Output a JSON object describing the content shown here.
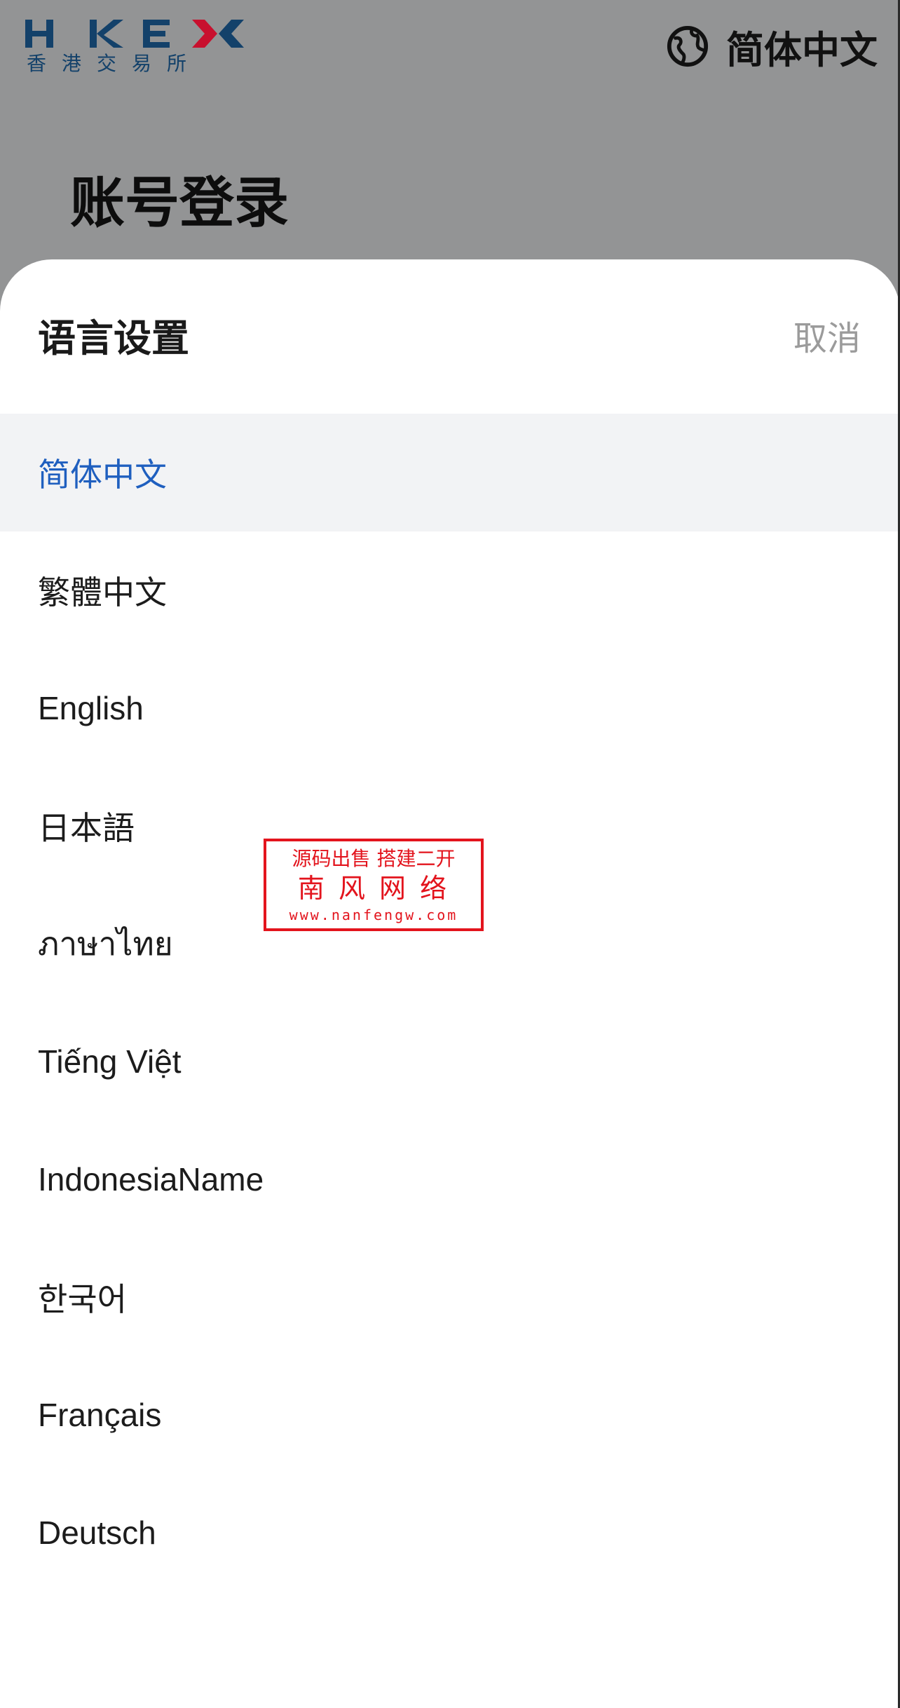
{
  "header": {
    "logo_text": "HKEX",
    "logo_subtext": "香港交易所",
    "globe_icon": "globe-icon",
    "current_language": "简体中文"
  },
  "page": {
    "title": "账号登录"
  },
  "language_sheet": {
    "title": "语言设置",
    "cancel_label": "取消",
    "selected_index": 0,
    "selected_color": "#1f5fbf",
    "options": [
      {
        "label": "简体中文"
      },
      {
        "label": "繁體中文"
      },
      {
        "label": "English"
      },
      {
        "label": "日本語"
      },
      {
        "label": "ภาษาไทย"
      },
      {
        "label": "Tiếng Việt"
      },
      {
        "label": "IndonesiaName"
      },
      {
        "label": "한국어"
      },
      {
        "label": "Français"
      },
      {
        "label": "Deutsch"
      }
    ]
  },
  "watermark": {
    "line1": "源码出售 搭建二开",
    "line2": "南 风 网 络",
    "line3": "www.nanfengw.com",
    "color": "#e3141d"
  },
  "colors": {
    "backdrop": "#939495",
    "brand_navy": "#13416a",
    "brand_red": "#c8102e"
  }
}
